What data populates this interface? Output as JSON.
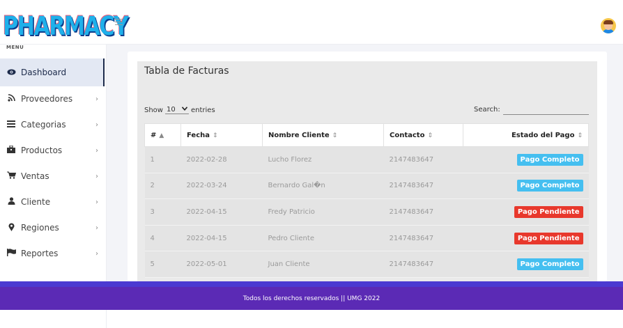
{
  "header": {
    "logo_text": "PHARMACY",
    "colors": {
      "logo": "#1fb0ea",
      "logo_shadow": "#0b3c8c"
    }
  },
  "sidebar": {
    "menu_title": "MENU",
    "items": [
      {
        "label": "Dashboard",
        "icon": "eye-icon",
        "active": true
      },
      {
        "label": "Proveedores",
        "icon": "rss-icon"
      },
      {
        "label": "Categorias",
        "icon": "list-icon"
      },
      {
        "label": "Productos",
        "icon": "briefcase-icon"
      },
      {
        "label": "Ventas",
        "icon": "cart-icon"
      },
      {
        "label": "Cliente",
        "icon": "user-icon"
      },
      {
        "label": "Regiones",
        "icon": "map-marker-icon"
      },
      {
        "label": "Reportes",
        "icon": "flag-icon"
      }
    ]
  },
  "main": {
    "title": "Tabla de Facturas",
    "show_label": "Show",
    "entries_value": "10",
    "entries_label": "entries",
    "search_label": "Search:",
    "search_value": "",
    "columns": [
      "#",
      "Fecha",
      "Nombre Cliente",
      "Contacto",
      "Estado del Pago"
    ],
    "rows": [
      {
        "num": "1",
        "fecha": "2022-02-28",
        "cliente": "Lucho Florez",
        "contacto": "2147483647",
        "estado": "Pago Completo",
        "status": "complete"
      },
      {
        "num": "2",
        "fecha": "2022-03-24",
        "cliente": "Bernardo Gal�n",
        "contacto": "2147483647",
        "estado": "Pago Completo",
        "status": "complete"
      },
      {
        "num": "3",
        "fecha": "2022-04-15",
        "cliente": "Fredy Patricio",
        "contacto": "2147483647",
        "estado": "Pago Pendiente",
        "status": "pending"
      },
      {
        "num": "4",
        "fecha": "2022-04-15",
        "cliente": "Pedro Cliente",
        "contacto": "2147483647",
        "estado": "Pago Pendiente",
        "status": "pending"
      },
      {
        "num": "5",
        "fecha": "2022-05-01",
        "cliente": "Juan Cliente",
        "contacto": "2147483647",
        "estado": "Pago Completo",
        "status": "complete"
      }
    ]
  },
  "footer": {
    "text": "Todos los derechos reservados || UMG 2022",
    "colors": {
      "bar": "#5b2ab5",
      "top_strip": "#4b3ad1"
    }
  },
  "status_colors": {
    "complete": "#45bff0",
    "pending": "#e8382c"
  }
}
